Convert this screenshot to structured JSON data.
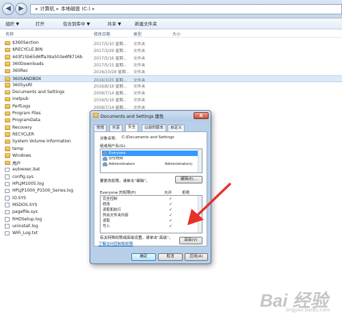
{
  "address": {
    "part1": "计算机",
    "part2": "本地磁盘 (C:)"
  },
  "toolbar": {
    "organize": "组织 ▼",
    "open": "打开",
    "include_library": "包含到库中 ▼",
    "share": "共享 ▼",
    "new_folder": "新建文件夹"
  },
  "columns": {
    "name": "名称",
    "date": "修改日期",
    "type": "类型",
    "size": "大小"
  },
  "files": [
    {
      "name": "$360Section",
      "date": "2017/5/10 星期...",
      "type": "文件夹",
      "kind": "folder"
    },
    {
      "name": "$RECYCLE.BIN",
      "date": "2017/3/29 星期...",
      "type": "文件夹",
      "kind": "folder"
    },
    {
      "name": "4d3f15b65d6ffa39a503e6f8716b",
      "date": "2017/5/16 星期...",
      "type": "文件夹",
      "kind": "folder"
    },
    {
      "name": "360Downloads",
      "date": "2017/5/15 星期...",
      "type": "文件夹",
      "kind": "folder"
    },
    {
      "name": "360Rec",
      "date": "2016/10/28 星期...",
      "type": "文件夹",
      "kind": "folder"
    },
    {
      "name": "360SANDBOX",
      "date": "2016/3/25 星期...",
      "type": "文件夹",
      "kind": "folder",
      "selected": true
    },
    {
      "name": "360SysRt",
      "date": "2016/8/18 星期...",
      "type": "文件夹",
      "kind": "folder"
    },
    {
      "name": "Documents and Settings",
      "date": "2009/7/14 星期...",
      "type": "文件夹",
      "kind": "lock"
    },
    {
      "name": "inetpub",
      "date": "2016/5/16 星期...",
      "type": "文件夹",
      "kind": "folder"
    },
    {
      "name": "PerfLogs",
      "date": "2009/7/14 星期...",
      "type": "文件夹",
      "kind": "folder"
    },
    {
      "name": "Program Files",
      "date": "",
      "type": "",
      "kind": "folder"
    },
    {
      "name": "ProgramData",
      "date": "",
      "type": "",
      "kind": "folder"
    },
    {
      "name": "Recovery",
      "date": "",
      "type": "",
      "kind": "folder"
    },
    {
      "name": "RECYCLER",
      "date": "",
      "type": "",
      "kind": "folder"
    },
    {
      "name": "System Volume Information",
      "date": "",
      "type": "",
      "kind": "folder"
    },
    {
      "name": "temp",
      "date": "",
      "type": "",
      "kind": "folder"
    },
    {
      "name": "Windows",
      "date": "",
      "type": "",
      "kind": "folder"
    },
    {
      "name": "用户",
      "date": "",
      "type": "",
      "kind": "folder"
    },
    {
      "name": "autoexec.bat",
      "date": "",
      "type": "",
      "kind": "file"
    },
    {
      "name": "config.sys",
      "date": "",
      "type": "",
      "kind": "file"
    },
    {
      "name": "HPLJM1005.log",
      "date": "",
      "type": "",
      "kind": "file"
    },
    {
      "name": "HPLJP1000_P1500_Series.log",
      "date": "",
      "type": "",
      "kind": "file"
    },
    {
      "name": "IO.SYS",
      "date": "",
      "type": "",
      "kind": "file"
    },
    {
      "name": "MSDOS.SYS",
      "date": "",
      "type": "",
      "kind": "file"
    },
    {
      "name": "pagefile.sys",
      "date": "",
      "type": "",
      "kind": "file"
    },
    {
      "name": "RHDSetup.log",
      "date": "",
      "type": "",
      "kind": "file"
    },
    {
      "name": "uninstall.log",
      "date": "",
      "type": "",
      "kind": "file"
    },
    {
      "name": "WiFi_Log.txt",
      "date": "",
      "type": "",
      "kind": "file"
    }
  ],
  "dialog": {
    "title": "Documents and Settings 属性",
    "close": "X",
    "tabs": [
      "常规",
      "共享",
      "安全",
      "以前的版本",
      "自定义"
    ],
    "active_tab_index": 2,
    "object_label": "对象名称:",
    "object_value": "C:\\Documents and Settings",
    "group_label": "组或用户名(G):",
    "users": [
      {
        "name": "Everyone",
        "selected": true
      },
      {
        "name": "SYSTEM",
        "selected": false
      },
      {
        "name": "Administrators",
        "suffix": "Administrators)",
        "selected": false
      }
    ],
    "change_hint": "要更改权限，请单击“编辑”。",
    "edit_button": "编辑(E)...",
    "perm_header": "Everyone 的权限(P)",
    "allow": "允许",
    "deny": "拒绝",
    "permissions": [
      {
        "name": "完全控制",
        "allow": "✓"
      },
      {
        "name": "修改",
        "allow": "✓"
      },
      {
        "name": "读取和执行",
        "allow": "✓"
      },
      {
        "name": "列出文件夹内容",
        "allow": "✓"
      },
      {
        "name": "读取",
        "allow": "✓"
      },
      {
        "name": "写入",
        "allow": "✓"
      }
    ],
    "special_hint": "有关特殊权限或高级设置，请单击“高级”。",
    "advanced_button": "高级(V)",
    "link": "了解访问控制和权限",
    "ok": "确定",
    "cancel": "取消",
    "apply": "应用(A)"
  },
  "watermark": {
    "text": "Bai 经验",
    "sub": "jingyan.baidu.com"
  },
  "colors": {
    "arrow": "#e8302a",
    "selection": "#3399ff",
    "dialog_frame": "#b7cfe8"
  }
}
